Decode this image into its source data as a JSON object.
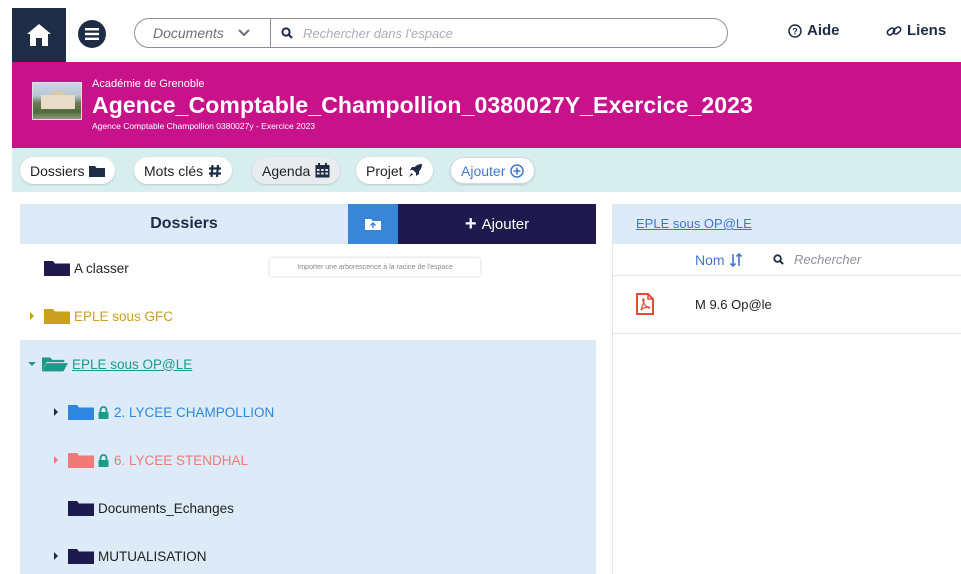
{
  "topbar": {
    "search_scope": "Documents",
    "search_placeholder": "Rechercher dans l'espace",
    "help_label": "Aide",
    "links_label": "Liens"
  },
  "banner": {
    "academy": "Académie de Grenoble",
    "title": "Agence_Comptable_Champollion_0380027Y_Exercice_2023",
    "subtitle": "Agence Comptable Champollion 0380027y - Exercice 2023"
  },
  "tabs": [
    {
      "label": "Dossiers",
      "icon": "folder-icon"
    },
    {
      "label": "Mots clés",
      "icon": "hash-icon"
    },
    {
      "label": "Agenda",
      "icon": "calendar-icon"
    },
    {
      "label": "Projet",
      "icon": "rocket-icon"
    },
    {
      "label": "Ajouter",
      "icon": "plus-circle-icon"
    }
  ],
  "left_panel": {
    "title": "Dossiers",
    "add_label": "Ajouter",
    "import_tooltip": "Importer une arborescence à la racine de l'espace",
    "tree": [
      {
        "label": "A classer",
        "color": "#1e1a4d",
        "caret": "none",
        "locked": false
      },
      {
        "label": "EPLE sous GFC",
        "color": "#c9a020",
        "caret": "right",
        "locked": false
      },
      {
        "label": "EPLE sous OP@LE",
        "color": "#1c9a8a",
        "caret": "down",
        "locked": false,
        "selected": true
      },
      {
        "label": "2. LYCEE CHAMPOLLION",
        "color": "#2f86e0",
        "caret": "right",
        "locked": true
      },
      {
        "label": "6. LYCEE STENDHAL",
        "color": "#f07a78",
        "caret": "right",
        "locked": true
      },
      {
        "label": "Documents_Echanges",
        "color": "#1e1a4d",
        "caret": "none",
        "locked": false
      },
      {
        "label": "MUTUALISATION",
        "color": "#1e1a4d",
        "caret": "right",
        "locked": false
      }
    ]
  },
  "right_panel": {
    "breadcrumb": "EPLE sous OP@LE",
    "col_name": "Nom",
    "search_placeholder": "Rechercher",
    "files": [
      {
        "name": "M 9.6 Op@le",
        "type": "pdf"
      }
    ]
  },
  "colors": {
    "banner": "#c8128a",
    "dark_navy": "#1e2c46",
    "tab_bar": "#d8eeee",
    "panel_header": "#dcebf7",
    "link_blue": "#3f78c8"
  }
}
